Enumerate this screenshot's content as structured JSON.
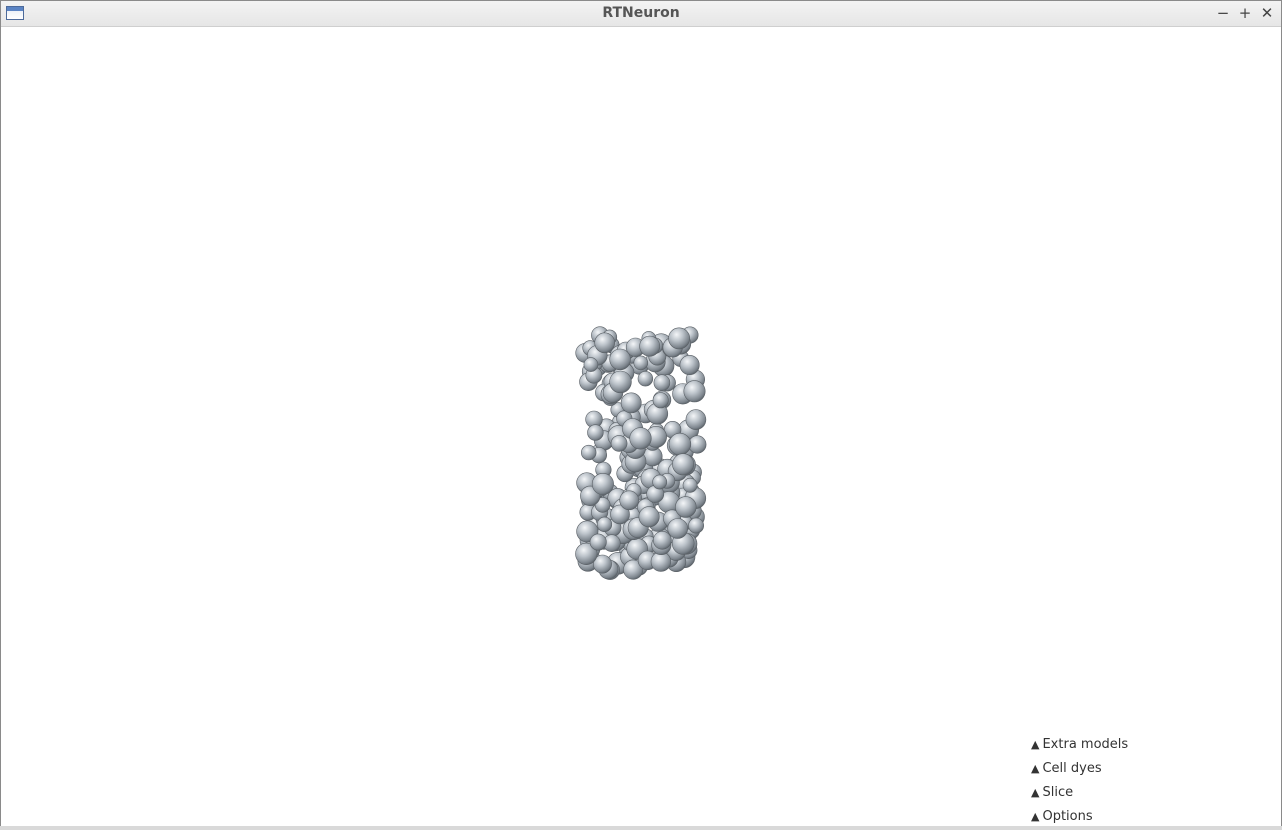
{
  "window": {
    "title": "RTNeuron",
    "icon": "app-window-icon",
    "controls": {
      "minimize": "−",
      "maximize": "+",
      "close": "✕"
    }
  },
  "scene": {
    "description_icon": "neuron-spheres-render",
    "sphere_color": "#b9bfc6"
  },
  "panel": {
    "items": [
      {
        "arrow": "▲",
        "label": "Extra models"
      },
      {
        "arrow": "▲",
        "label": "Cell dyes"
      },
      {
        "arrow": "▲",
        "label": "Slice"
      },
      {
        "arrow": "▲",
        "label": "Options"
      }
    ]
  }
}
